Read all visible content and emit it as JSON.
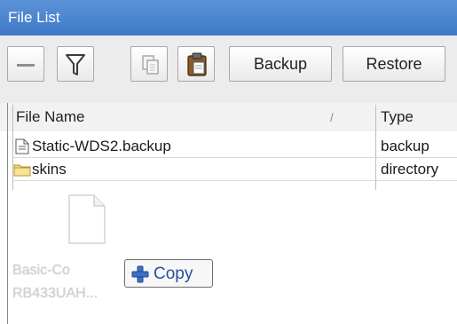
{
  "window": {
    "title": "File List"
  },
  "toolbar": {
    "remove_icon": "minus-icon",
    "filter_icon": "filter-funnel-icon",
    "copy_icon": "copy-icon",
    "paste_icon": "paste-clipboard-icon",
    "backup_label": "Backup",
    "restore_label": "Restore"
  },
  "table": {
    "columns": [
      "File Name",
      "Type"
    ],
    "sorted_column": "File Name",
    "rows": [
      {
        "name": "Static-WDS2.backup",
        "type": "backup",
        "icon": "file-icon"
      },
      {
        "name": "skins",
        "type": "directory",
        "icon": "folder-icon"
      }
    ]
  },
  "drag": {
    "file_icon": "file-icon",
    "label_line1": "Basic-Co",
    "label_line2": "RB433UAH...",
    "action_icon": "plus-icon",
    "action_label": "Copy"
  },
  "colors": {
    "titlebar": "#4a86d0",
    "toolbar": "#ececec",
    "accent_text": "#2a4f9a"
  }
}
